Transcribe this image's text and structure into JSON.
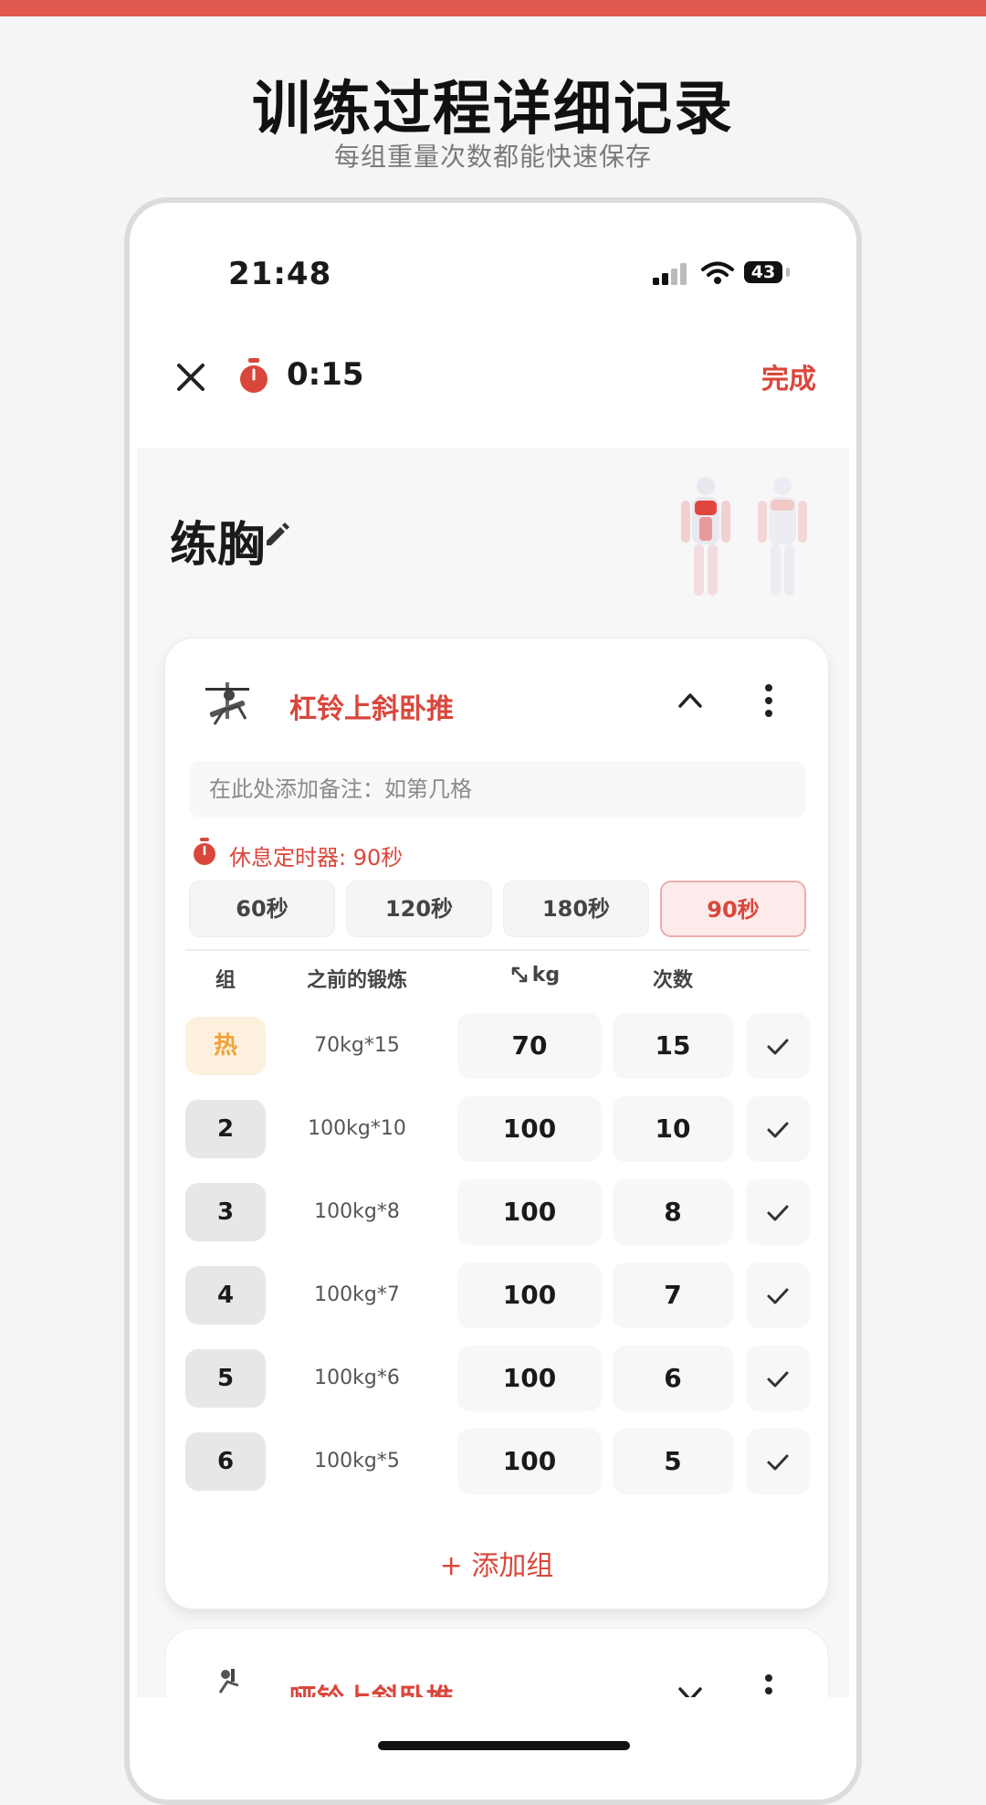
{
  "promo": {
    "headline": "训练过程详细记录",
    "subline": "每组重量次数都能快速保存"
  },
  "status_bar": {
    "time": "21:48",
    "battery": "43"
  },
  "nav": {
    "elapsed": "0:15",
    "done_label": "完成"
  },
  "workout": {
    "title": "练胸"
  },
  "exercise": {
    "name": "杠铃上斜卧推",
    "note_placeholder": "在此处添加备注：如第几格",
    "rest_timer_label": "休息定时器: 90秒",
    "rest_options": [
      "60秒",
      "120秒",
      "180秒",
      "90秒"
    ],
    "rest_selected": "90秒",
    "columns": {
      "set": "组",
      "previous": "之前的锻炼",
      "weight": "kg",
      "reps": "次数"
    },
    "sets": [
      {
        "set": "热",
        "previous": "70kg*15",
        "weight": "70",
        "reps": "15"
      },
      {
        "set": "2",
        "previous": "100kg*10",
        "weight": "100",
        "reps": "10"
      },
      {
        "set": "3",
        "previous": "100kg*8",
        "weight": "100",
        "reps": "8"
      },
      {
        "set": "4",
        "previous": "100kg*7",
        "weight": "100",
        "reps": "7"
      },
      {
        "set": "5",
        "previous": "100kg*6",
        "weight": "100",
        "reps": "6"
      },
      {
        "set": "6",
        "previous": "100kg*5",
        "weight": "100",
        "reps": "5"
      }
    ],
    "add_set_label": "+ 添加组"
  },
  "next_exercise": {
    "name": "哑铃上斜卧推"
  },
  "colors": {
    "accent": "#d9473c",
    "warmup": "#f0a23a"
  }
}
